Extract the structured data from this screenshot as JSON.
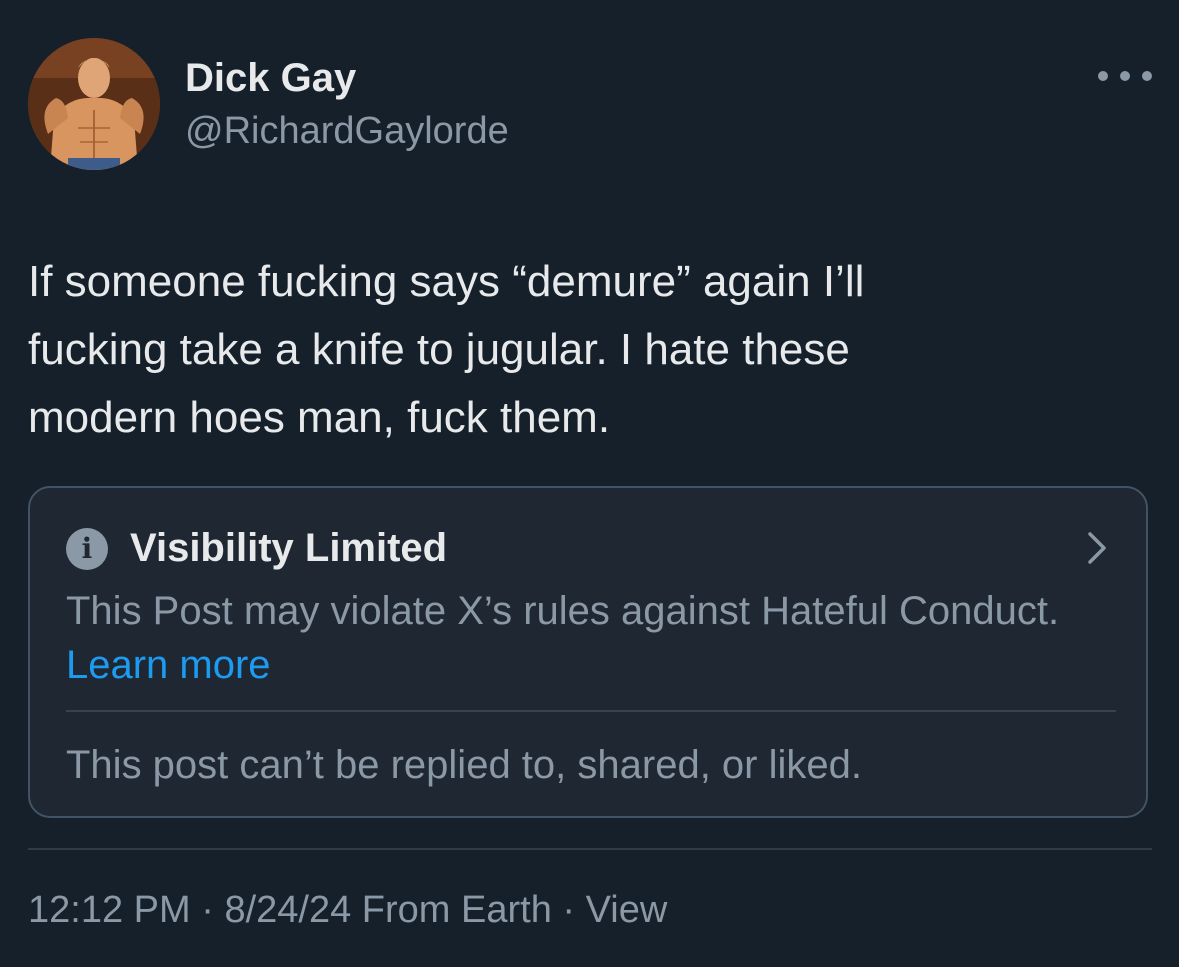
{
  "author": {
    "display_name": "Dick Gay",
    "handle": "@RichardGaylorde",
    "avatar_icon": "profile-photo-avatar"
  },
  "more_icon": "more-horizontal-icon",
  "post": {
    "text": "If someone fucking says “demure” again I’ll\nfucking take a knife to jugular. I hate these\nmodern hoes man, fuck them."
  },
  "notice": {
    "icon": "info-icon",
    "icon_glyph": "i",
    "title": "Visibility Limited",
    "body": "This Post may violate X’s rules against Hateful Conduct.",
    "learn_more": "Learn more",
    "footer": "This post can’t be replied to, shared, or liked.",
    "chevron_icon": "chevron-right-icon"
  },
  "meta": {
    "time": "12:12 PM",
    "separator": " · ",
    "date": "8/24/24",
    "location": "From Earth",
    "separator2": " · ",
    "view_label": "View"
  },
  "colors": {
    "background": "#15202b",
    "card_background": "#1e2732",
    "card_border": "#425364",
    "primary_text": "#e7e9ea",
    "secondary_text": "#8b98a5",
    "link": "#1d9bf0"
  }
}
